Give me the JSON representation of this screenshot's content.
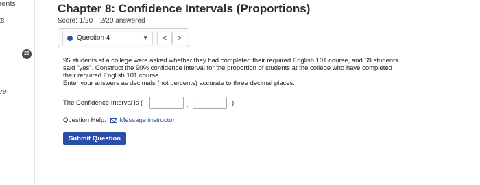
{
  "sidebar": {
    "items": [
      {
        "label": "nents"
      },
      {
        "label": "ts"
      },
      {
        "label": "ve"
      }
    ]
  },
  "header": {
    "title": "Chapter 8: Confidence Intervals (Proportions)",
    "score": "Score: 1/20",
    "answered": "2/20 answered"
  },
  "question_nav": {
    "selected": "Question 4",
    "prev_symbol": "<",
    "next_symbol": ">"
  },
  "question": {
    "number": "28",
    "text": "95 students at a college were asked whether they had completed their required English 101 course, and 69 students said \"yes\". Construct the 90% confidence interval for the proportion of students at the college who have completed their required English 101 course.",
    "instruction": "Enter your answers as decimals (not percents) accurate to three decimal places.",
    "ci_label": "The Confidence Interval is (",
    "comma": ",",
    "close_paren": ")",
    "lower_value": "",
    "upper_value": "",
    "help_label": "Question Help:",
    "message_link": "Message instructor",
    "submit_label": "Submit Question"
  },
  "colors": {
    "accent": "#2a4fa8",
    "badge": "#4a4a4a"
  }
}
